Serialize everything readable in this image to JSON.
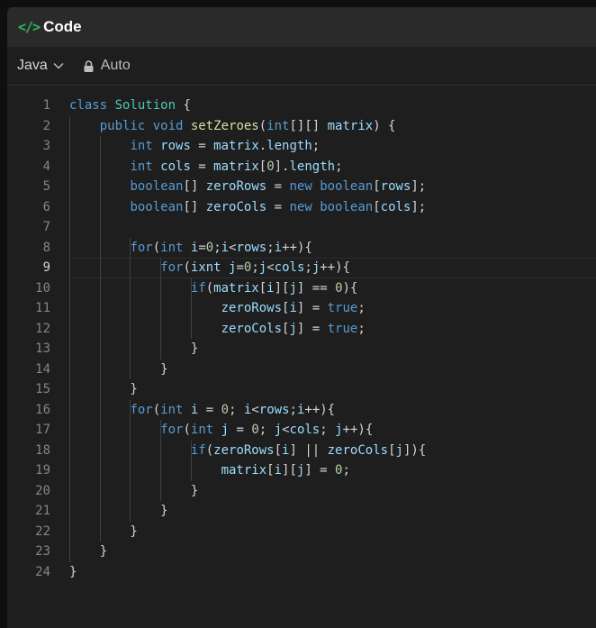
{
  "panel": {
    "title": "Code",
    "title_icon": "</>"
  },
  "toolbar": {
    "language": "Java",
    "mode": "Auto"
  },
  "editor": {
    "current_line": 9,
    "lines": [
      [
        [
          "class ",
          "kw"
        ],
        [
          "Solution",
          "ty"
        ],
        [
          " {",
          ""
        ]
      ],
      [
        [
          "    ",
          ""
        ],
        [
          "public void ",
          "kw"
        ],
        [
          "setZeroes",
          "fn"
        ],
        [
          "(",
          ""
        ],
        [
          "int",
          "kw"
        ],
        [
          "[][] ",
          ""
        ],
        [
          "matrix",
          "var"
        ],
        [
          ") {",
          ""
        ]
      ],
      [
        [
          "        ",
          ""
        ],
        [
          "int ",
          "kw"
        ],
        [
          "rows",
          "var"
        ],
        [
          " = ",
          ""
        ],
        [
          "matrix",
          "var"
        ],
        [
          ".",
          ""
        ],
        [
          "length",
          "var"
        ],
        [
          ";",
          ""
        ]
      ],
      [
        [
          "        ",
          ""
        ],
        [
          "int ",
          "kw"
        ],
        [
          "cols",
          "var"
        ],
        [
          " = ",
          ""
        ],
        [
          "matrix",
          "var"
        ],
        [
          "[",
          ""
        ],
        [
          "0",
          "num"
        ],
        [
          "].",
          ""
        ],
        [
          "length",
          "var"
        ],
        [
          ";",
          ""
        ]
      ],
      [
        [
          "        ",
          ""
        ],
        [
          "boolean",
          "kw"
        ],
        [
          "[] ",
          ""
        ],
        [
          "zeroRows",
          "var"
        ],
        [
          " = ",
          ""
        ],
        [
          "new ",
          "kw"
        ],
        [
          "boolean",
          "kw"
        ],
        [
          "[",
          ""
        ],
        [
          "rows",
          "var"
        ],
        [
          "];",
          ""
        ]
      ],
      [
        [
          "        ",
          ""
        ],
        [
          "boolean",
          "kw"
        ],
        [
          "[] ",
          ""
        ],
        [
          "zeroCols",
          "var"
        ],
        [
          " = ",
          ""
        ],
        [
          "new ",
          "kw"
        ],
        [
          "boolean",
          "kw"
        ],
        [
          "[",
          ""
        ],
        [
          "cols",
          "var"
        ],
        [
          "];",
          ""
        ]
      ],
      [],
      [
        [
          "        ",
          ""
        ],
        [
          "for",
          "kw"
        ],
        [
          "(",
          ""
        ],
        [
          "int ",
          "kw"
        ],
        [
          "i",
          "var"
        ],
        [
          "=",
          ""
        ],
        [
          "0",
          "num"
        ],
        [
          ";",
          ""
        ],
        [
          "i",
          "var"
        ],
        [
          "<",
          ""
        ],
        [
          "rows",
          "var"
        ],
        [
          ";",
          ""
        ],
        [
          "i",
          "var"
        ],
        [
          "++){",
          ""
        ]
      ],
      [
        [
          "            ",
          ""
        ],
        [
          "for",
          "kw"
        ],
        [
          "(",
          ""
        ],
        [
          "ixnt ",
          "var"
        ],
        [
          "j",
          "var"
        ],
        [
          "=",
          ""
        ],
        [
          "0",
          "num"
        ],
        [
          ";",
          ""
        ],
        [
          "j",
          "var"
        ],
        [
          "<",
          ""
        ],
        [
          "cols",
          "var"
        ],
        [
          ";",
          ""
        ],
        [
          "j",
          "var"
        ],
        [
          "++){",
          ""
        ]
      ],
      [
        [
          "                ",
          ""
        ],
        [
          "if",
          "kw"
        ],
        [
          "(",
          ""
        ],
        [
          "matrix",
          "var"
        ],
        [
          "[",
          ""
        ],
        [
          "i",
          "var"
        ],
        [
          "][",
          ""
        ],
        [
          "j",
          "var"
        ],
        [
          "] == ",
          ""
        ],
        [
          "0",
          "num"
        ],
        [
          "){",
          ""
        ]
      ],
      [
        [
          "                    ",
          ""
        ],
        [
          "zeroRows",
          "var"
        ],
        [
          "[",
          ""
        ],
        [
          "i",
          "var"
        ],
        [
          "] = ",
          ""
        ],
        [
          "true",
          "kw"
        ],
        [
          ";",
          ""
        ]
      ],
      [
        [
          "                    ",
          ""
        ],
        [
          "zeroCols",
          "var"
        ],
        [
          "[",
          ""
        ],
        [
          "j",
          "var"
        ],
        [
          "] = ",
          ""
        ],
        [
          "true",
          "kw"
        ],
        [
          ";",
          ""
        ]
      ],
      [
        [
          "                }",
          ""
        ]
      ],
      [
        [
          "            }",
          ""
        ]
      ],
      [
        [
          "        }",
          ""
        ]
      ],
      [
        [
          "        ",
          ""
        ],
        [
          "for",
          "kw"
        ],
        [
          "(",
          ""
        ],
        [
          "int ",
          "kw"
        ],
        [
          "i",
          "var"
        ],
        [
          " = ",
          ""
        ],
        [
          "0",
          "num"
        ],
        [
          "; ",
          ""
        ],
        [
          "i",
          "var"
        ],
        [
          "<",
          ""
        ],
        [
          "rows",
          "var"
        ],
        [
          ";",
          ""
        ],
        [
          "i",
          "var"
        ],
        [
          "++){",
          ""
        ]
      ],
      [
        [
          "            ",
          ""
        ],
        [
          "for",
          "kw"
        ],
        [
          "(",
          ""
        ],
        [
          "int ",
          "kw"
        ],
        [
          "j",
          "var"
        ],
        [
          " = ",
          ""
        ],
        [
          "0",
          "num"
        ],
        [
          "; ",
          ""
        ],
        [
          "j",
          "var"
        ],
        [
          "<",
          ""
        ],
        [
          "cols",
          "var"
        ],
        [
          "; ",
          ""
        ],
        [
          "j",
          "var"
        ],
        [
          "++){",
          ""
        ]
      ],
      [
        [
          "                ",
          ""
        ],
        [
          "if",
          "kw"
        ],
        [
          "(",
          ""
        ],
        [
          "zeroRows",
          "var"
        ],
        [
          "[",
          ""
        ],
        [
          "i",
          "var"
        ],
        [
          "] || ",
          ""
        ],
        [
          "zeroCols",
          "var"
        ],
        [
          "[",
          ""
        ],
        [
          "j",
          "var"
        ],
        [
          "]){",
          ""
        ]
      ],
      [
        [
          "                    ",
          ""
        ],
        [
          "matrix",
          "var"
        ],
        [
          "[",
          ""
        ],
        [
          "i",
          "var"
        ],
        [
          "][",
          ""
        ],
        [
          "j",
          "var"
        ],
        [
          "] = ",
          ""
        ],
        [
          "0",
          "num"
        ],
        [
          ";",
          ""
        ]
      ],
      [
        [
          "                }",
          ""
        ]
      ],
      [
        [
          "            }",
          ""
        ]
      ],
      [
        [
          "        }",
          ""
        ]
      ],
      [
        [
          "    }",
          ""
        ]
      ],
      [
        [
          "}",
          ""
        ]
      ]
    ]
  }
}
